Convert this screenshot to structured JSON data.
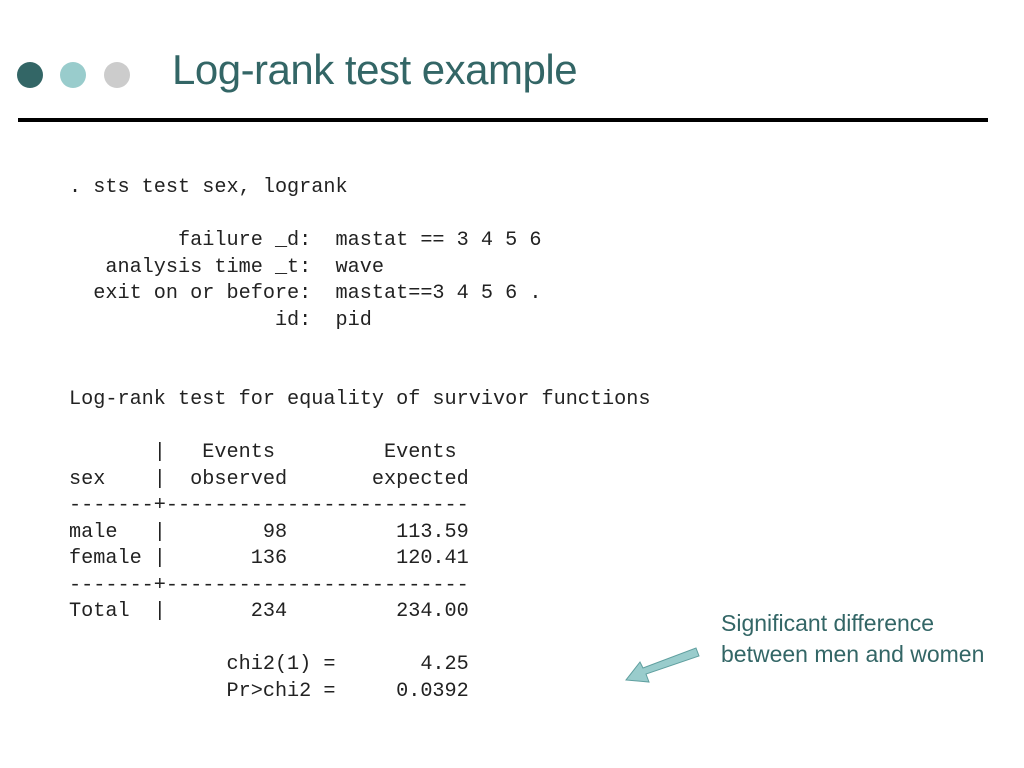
{
  "slide": {
    "title": "Log-rank test example",
    "bullet_dots": [
      {
        "name": "dark-teal-dot",
        "color": "#336666"
      },
      {
        "name": "light-teal-dot",
        "color": "#99CCCC"
      },
      {
        "name": "gray-dot",
        "color": "#CCCCCC"
      }
    ],
    "accent_color": "#336666",
    "arrow_color": "#99CCCC"
  },
  "console": {
    "lines": [
      ". sts test sex, logrank",
      "",
      "         failure _d:  mastat == 3 4 5 6",
      "   analysis time _t:  wave",
      "  exit on or before:  mastat==3 4 5 6 .",
      "                 id:  pid",
      "",
      "",
      "Log-rank test for equality of survivor functions",
      "",
      "       |   Events         Events",
      "sex    |  observed       expected",
      "-------+-------------------------",
      "male   |        98         113.59",
      "female |       136         120.41",
      "-------+-------------------------",
      "Total  |       234         234.00",
      "",
      "             chi2(1) =       4.25",
      "             Pr>chi2 =     0.0392"
    ],
    "command": ". sts test sex, logrank",
    "settings": [
      {
        "label": "failure _d",
        "value": "mastat == 3 4 5 6"
      },
      {
        "label": "analysis time _t",
        "value": "wave"
      },
      {
        "label": "exit on or before",
        "value": "mastat==3 4 5 6 ."
      },
      {
        "label": "id",
        "value": "pid"
      }
    ],
    "table": {
      "heading": "Log-rank test for equality of survivor functions",
      "columns": [
        "sex",
        "Events observed",
        "Events expected"
      ],
      "rows": [
        {
          "sex": "male",
          "observed": "98",
          "expected": "113.59"
        },
        {
          "sex": "female",
          "observed": "136",
          "expected": "120.41"
        }
      ],
      "total": {
        "sex": "Total",
        "observed": "234",
        "expected": "234.00"
      },
      "chi2_label": "chi2(1)",
      "chi2": "4.25",
      "p_label": "Pr>chi2",
      "p_value": "0.0392"
    }
  },
  "annotation": {
    "line1": "Significant difference",
    "line2": "between men and women",
    "arrow_icon": "arrow-down-left-icon"
  }
}
